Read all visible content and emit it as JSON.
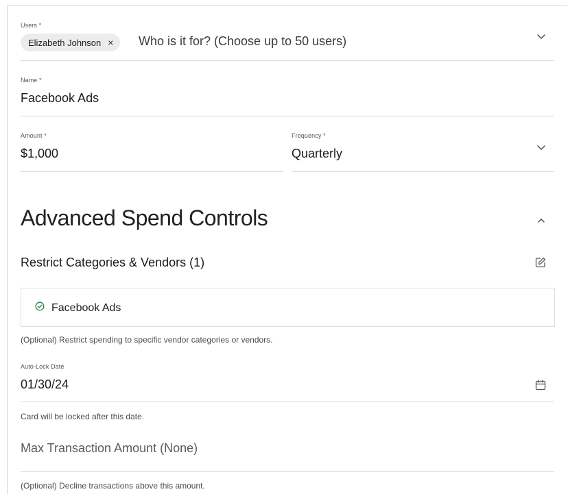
{
  "users": {
    "label": "Users *",
    "chip_name": "Elizabeth Johnson",
    "chip_remove": "×",
    "placeholder": "Who is it for? (Choose up to 50 users)"
  },
  "name_field": {
    "label": "Name *",
    "value": "Facebook Ads"
  },
  "amount_field": {
    "label": "Amount *",
    "value": "$1,000"
  },
  "frequency_field": {
    "label": "Frequency *",
    "value": "Quarterly"
  },
  "advanced": {
    "title": "Advanced Spend Controls",
    "restrict_title": "Restrict Categories & Vendors (1)",
    "vendors": [
      "Facebook Ads"
    ],
    "restrict_help": "(Optional) Restrict spending to specific vendor categories or vendors.",
    "autolock_label": "Auto-Lock Date",
    "autolock_value": "01/30/24",
    "autolock_help": "Card will be locked after this date.",
    "max_label": "Max Transaction Amount (None)",
    "max_help": "(Optional) Decline transactions above this amount."
  },
  "colors": {
    "accent_green": "#2e7d4f",
    "border": "#dcdcdc",
    "chip_bg": "#ececec"
  },
  "icons": {
    "dropdown": "chevron-down-icon",
    "collapse": "chevron-up-icon",
    "edit": "edit-icon",
    "check": "check-circle-icon",
    "calendar": "calendar-icon"
  }
}
